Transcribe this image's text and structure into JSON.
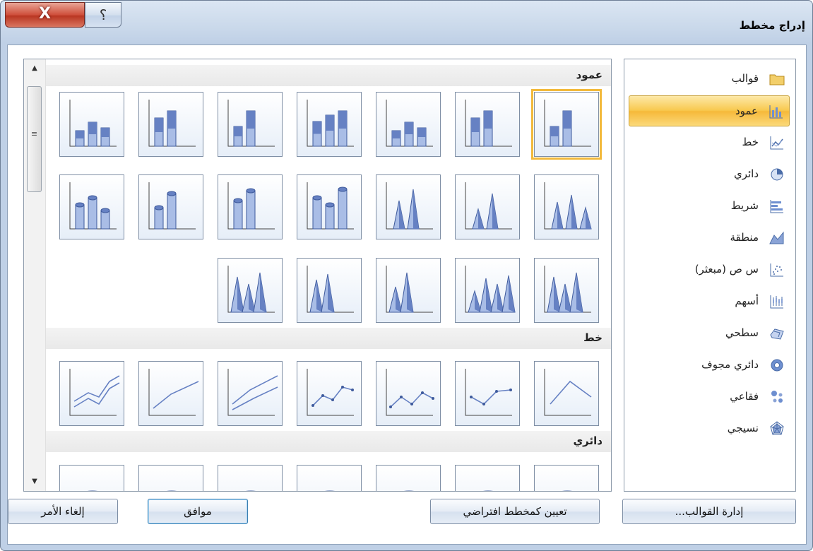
{
  "window": {
    "title": "إدراج مخطط",
    "close_glyph": "X",
    "help_glyph": "؟"
  },
  "types": [
    {
      "label": "قوالب",
      "icon": "folder-icon"
    },
    {
      "label": "عمود",
      "icon": "column-chart-icon",
      "selected": true
    },
    {
      "label": "خط",
      "icon": "line-chart-icon"
    },
    {
      "label": "دائري",
      "icon": "pie-chart-icon"
    },
    {
      "label": "شريط",
      "icon": "bar-chart-icon"
    },
    {
      "label": "منطقة",
      "icon": "area-chart-icon"
    },
    {
      "label": "س ص (مبعثر)",
      "icon": "scatter-chart-icon"
    },
    {
      "label": "أسهم",
      "icon": "stock-chart-icon"
    },
    {
      "label": "سطحي",
      "icon": "surface-chart-icon"
    },
    {
      "label": "دائري مجوف",
      "icon": "doughnut-chart-icon"
    },
    {
      "label": "فقاعي",
      "icon": "bubble-chart-icon"
    },
    {
      "label": "نسيجي",
      "icon": "radar-chart-icon"
    }
  ],
  "sections": {
    "column": "عمود",
    "line": "خط",
    "pie": "دائري"
  },
  "buttons": {
    "manage_templates": "إدارة القوالب...",
    "set_default": "تعيين كمخطط افتراضي",
    "ok": "موافق",
    "cancel": "إلغاء الأمر"
  },
  "colors": {
    "accent_selected": "#f8c94f",
    "chart_blue": "#5b7cc0"
  }
}
